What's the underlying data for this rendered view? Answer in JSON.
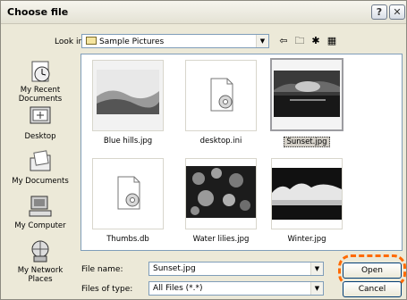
{
  "window": {
    "title": "Choose file",
    "help_icon": "?",
    "close_icon": "✕"
  },
  "lookin": {
    "label": "Look in:",
    "folder": "Sample Pictures"
  },
  "places": [
    {
      "label_line1": "My Recent",
      "label_line2": "Documents",
      "icon": "recent-documents-icon"
    },
    {
      "label_line1": "Desktop",
      "label_line2": "",
      "icon": "desktop-icon"
    },
    {
      "label_line1": "My Documents",
      "label_line2": "",
      "icon": "my-documents-icon"
    },
    {
      "label_line1": "My Computer",
      "label_line2": "",
      "icon": "my-computer-icon"
    },
    {
      "label_line1": "My Network",
      "label_line2": "Places",
      "icon": "network-places-icon"
    }
  ],
  "files": [
    {
      "name": "Blue hills.jpg",
      "kind": "image",
      "selected": false
    },
    {
      "name": "desktop.ini",
      "kind": "document",
      "selected": false
    },
    {
      "name": "Sunset.jpg",
      "kind": "image",
      "selected": true
    },
    {
      "name": "Thumbs.db",
      "kind": "document",
      "selected": false
    },
    {
      "name": "Water lilies.jpg",
      "kind": "image",
      "selected": false
    },
    {
      "name": "Winter.jpg",
      "kind": "image",
      "selected": false
    }
  ],
  "form": {
    "filename_label": "File name:",
    "filename_value": "Sunset.jpg",
    "filetype_label": "Files of type:",
    "filetype_value": "All Files (*.*)"
  },
  "buttons": {
    "open": "Open",
    "cancel": "Cancel"
  },
  "colors": {
    "highlight": "#ff6a00",
    "dialog_bg": "#ece9d8"
  }
}
